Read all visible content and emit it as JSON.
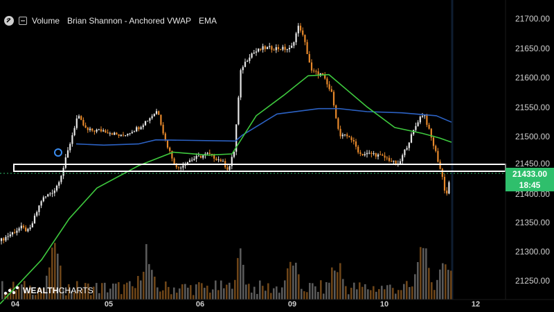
{
  "legend": {
    "items": [
      "Volume",
      "Brian Shannon - Anchored VWAP",
      "EMA"
    ]
  },
  "price_axis": {
    "ticks": [
      "21700.00",
      "21650.00",
      "21600.00",
      "21550.00",
      "21500.00",
      "21450.00",
      "21400.00",
      "21350.00",
      "21300.00",
      "21250.00"
    ]
  },
  "time_axis": {
    "ticks": [
      "04",
      "05",
      "06",
      "09",
      "10",
      "12"
    ]
  },
  "last_price": {
    "price": "21433.00",
    "countdown": "18:45"
  },
  "brand": {
    "name_bold": "WEALTH",
    "name_light": "CHARTS"
  },
  "colors": {
    "background": "#000000",
    "up_candle": "#e8e8e8",
    "down_candle": "#e8892b",
    "ema": "#3ec93e",
    "anchored_vwap": "#2c62c4",
    "price_tag": "#2fbf6c",
    "box": "#ffffff"
  },
  "icons": [
    "visibility-toggle-icon",
    "collapse-icon",
    "anchor-point-icon",
    "brand-logo-icon"
  ],
  "chart_data": {
    "type": "candlestick",
    "y_range": [
      21215,
      21720
    ],
    "x_labels": [
      "04",
      "05",
      "06",
      "09",
      "10",
      "12"
    ],
    "last_price": 21433.0,
    "highlight_zone": [
      21437,
      21450
    ],
    "path": [
      [
        0,
        21322
      ],
      [
        30,
        21345
      ],
      [
        42,
        21338
      ],
      [
        60,
        21392
      ],
      [
        80,
        21410
      ],
      [
        90,
        21440
      ],
      [
        105,
        21505
      ],
      [
        112,
        21535
      ],
      [
        125,
        21510
      ],
      [
        150,
        21510
      ],
      [
        175,
        21500
      ],
      [
        200,
        21515
      ],
      [
        215,
        21530
      ],
      [
        228,
        21545
      ],
      [
        238,
        21495
      ],
      [
        255,
        21445
      ],
      [
        275,
        21460
      ],
      [
        300,
        21470
      ],
      [
        320,
        21458
      ],
      [
        330,
        21443
      ],
      [
        338,
        21475
      ],
      [
        348,
        21615
      ],
      [
        362,
        21640
      ],
      [
        380,
        21650
      ],
      [
        400,
        21650
      ],
      [
        420,
        21648
      ],
      [
        432,
        21690
      ],
      [
        440,
        21660
      ],
      [
        450,
        21610
      ],
      [
        465,
        21605
      ],
      [
        480,
        21570
      ],
      [
        490,
        21500
      ],
      [
        505,
        21500
      ],
      [
        520,
        21470
      ],
      [
        540,
        21470
      ],
      [
        560,
        21462
      ],
      [
        575,
        21450
      ],
      [
        590,
        21490
      ],
      [
        605,
        21530
      ],
      [
        612,
        21540
      ],
      [
        622,
        21500
      ],
      [
        630,
        21470
      ],
      [
        640,
        21425
      ],
      [
        644,
        21395
      ],
      [
        650,
        21433
      ]
    ],
    "ema": [
      [
        0,
        21215
      ],
      [
        60,
        21290
      ],
      [
        100,
        21360
      ],
      [
        140,
        21412
      ],
      [
        200,
        21450
      ],
      [
        250,
        21473
      ],
      [
        300,
        21468
      ],
      [
        335,
        21470
      ],
      [
        370,
        21535
      ],
      [
        410,
        21570
      ],
      [
        445,
        21603
      ],
      [
        475,
        21605
      ],
      [
        500,
        21580
      ],
      [
        530,
        21550
      ],
      [
        570,
        21515
      ],
      [
        610,
        21505
      ],
      [
        635,
        21497
      ],
      [
        652,
        21490
      ]
    ],
    "anchored_vwap": [
      [
        110,
        21487
      ],
      [
        150,
        21485
      ],
      [
        200,
        21487
      ],
      [
        225,
        21494
      ],
      [
        340,
        21492
      ],
      [
        350,
        21502
      ],
      [
        400,
        21538
      ],
      [
        460,
        21547
      ],
      [
        490,
        21547
      ],
      [
        530,
        21542
      ],
      [
        580,
        21540
      ],
      [
        630,
        21535
      ],
      [
        652,
        21524
      ]
    ],
    "volume": {
      "bars": 160,
      "spikes": [
        [
          78,
          1.0
        ],
        [
          210,
          0.75
        ],
        [
          345,
          0.7
        ],
        [
          420,
          0.6
        ],
        [
          485,
          0.65
        ],
        [
          608,
          1.0
        ],
        [
          640,
          0.8
        ]
      ]
    }
  }
}
